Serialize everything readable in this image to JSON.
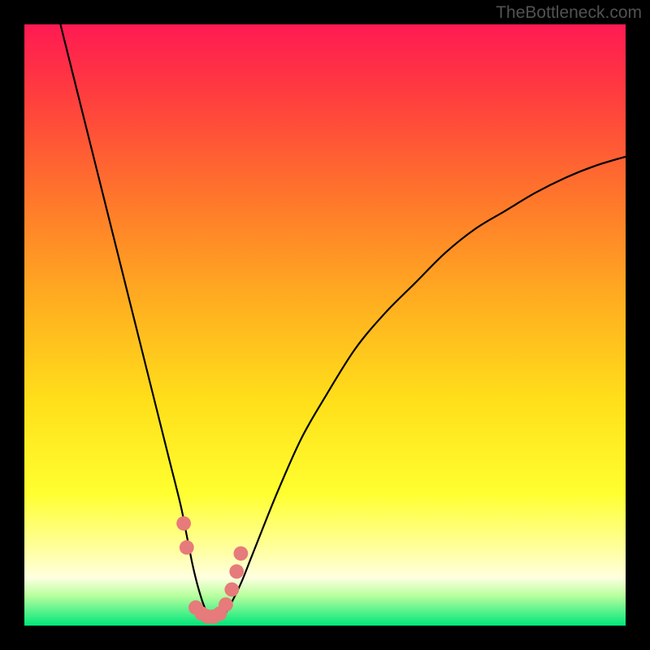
{
  "watermark": "TheBottleneck.com",
  "colors": {
    "gradient_stops": [
      {
        "offset": 0,
        "hex": "#ff1a53"
      },
      {
        "offset": 12,
        "hex": "#ff3e3e"
      },
      {
        "offset": 30,
        "hex": "#ff7a2a"
      },
      {
        "offset": 48,
        "hex": "#ffb41f"
      },
      {
        "offset": 63,
        "hex": "#ffe01a"
      },
      {
        "offset": 78,
        "hex": "#ffff30"
      },
      {
        "offset": 88,
        "hex": "#ffffa8"
      },
      {
        "offset": 92,
        "hex": "#ffffe0"
      },
      {
        "offset": 95,
        "hex": "#b8ff9e"
      },
      {
        "offset": 100,
        "hex": "#00e67a"
      }
    ],
    "curve_stroke": "#000000",
    "marker_fill": "#e77a7a",
    "frame_bg": "#000000"
  },
  "chart_data": {
    "type": "line",
    "title": "",
    "xlabel": "",
    "ylabel": "",
    "xlim": [
      0,
      100
    ],
    "ylim": [
      0,
      100
    ],
    "series": [
      {
        "name": "bottleneck-curve",
        "x": [
          6,
          8,
          10,
          12,
          14,
          16,
          18,
          20,
          22,
          24,
          26,
          27,
          28,
          29,
          30,
          31,
          32,
          33,
          34,
          36,
          38,
          42,
          46,
          50,
          55,
          60,
          65,
          70,
          75,
          80,
          85,
          90,
          95,
          100
        ],
        "y": [
          100,
          92,
          84,
          76,
          68,
          60,
          52,
          44,
          36,
          28,
          20,
          15,
          10,
          6,
          3,
          1.5,
          1,
          1.5,
          3,
          7,
          12,
          22,
          31,
          38,
          46,
          52,
          57,
          62,
          66,
          69,
          72,
          74.5,
          76.5,
          78
        ]
      }
    ],
    "markers": {
      "name": "highlight-points",
      "color": "#e77a7a",
      "radius_pct": 1.2,
      "points": [
        {
          "x": 26.5,
          "y": 17
        },
        {
          "x": 27.0,
          "y": 13
        },
        {
          "x": 28.5,
          "y": 3
        },
        {
          "x": 29.5,
          "y": 2
        },
        {
          "x": 30.5,
          "y": 1.5
        },
        {
          "x": 31.5,
          "y": 1.5
        },
        {
          "x": 32.5,
          "y": 2
        },
        {
          "x": 33.5,
          "y": 3.5
        },
        {
          "x": 34.5,
          "y": 6
        },
        {
          "x": 35.3,
          "y": 9
        },
        {
          "x": 36.0,
          "y": 12
        }
      ]
    }
  }
}
